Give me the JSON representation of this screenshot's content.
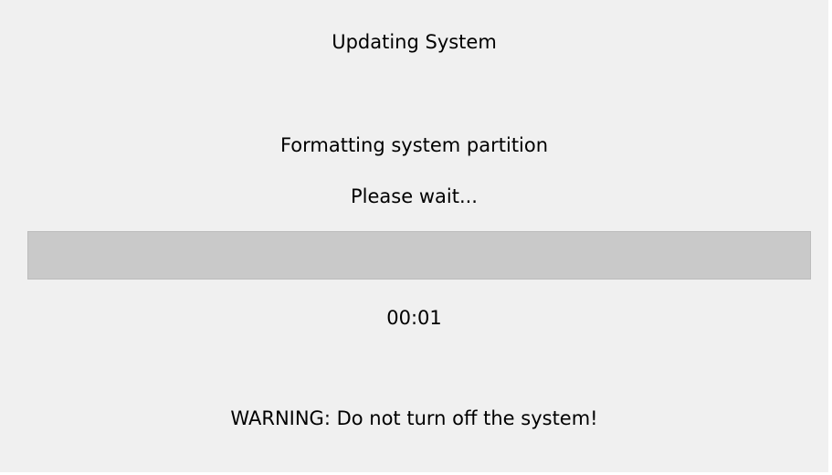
{
  "dialog": {
    "title": "Updating System",
    "status": "Formatting system partition",
    "wait_message": "Please wait...",
    "progress": {
      "fraction": 1.0
    },
    "elapsed_time": "00:01",
    "warning": "WARNING: Do not turn off the system!"
  },
  "colors": {
    "background": "#f0f0f0",
    "progress_fill": "#c9c9c9",
    "progress_border": "#bcbcbc"
  }
}
